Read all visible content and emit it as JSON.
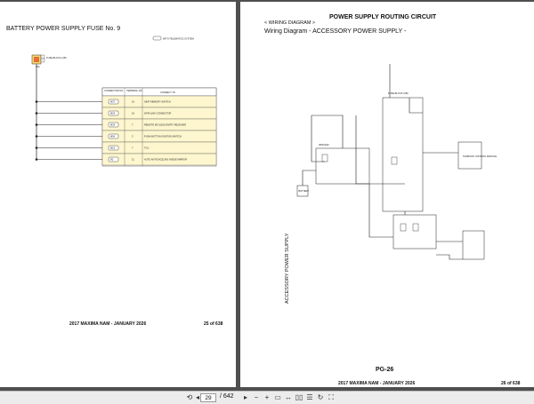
{
  "left_page": {
    "fuse_title": "BATTERY POWER SUPPLY FUSE No. 9",
    "note": "WITH TELEMATICS SYSTEM",
    "fuse_block": "FUSE BLOCK (J/B)",
    "fuse_amp": "10A",
    "table_headers": [
      "CONNECTOR NO.",
      "TERMINAL NO.",
      "CONNECT TO"
    ],
    "rows": [
      {
        "connector": "M37",
        "terminal": "16",
        "connect_to": "SEAT MEMORY SWITCH"
      },
      {
        "connector": "M24",
        "terminal": "16",
        "connect_to": "DATA LINK CONNECTOR"
      },
      {
        "connector": "M33",
        "terminal": "7",
        "connect_to": "REMOTE KEYLESS ENTRY RECEIVER"
      },
      {
        "connector": "M54",
        "terminal": "3",
        "connect_to": "PUSH-BUTTON IGNITION SWITCH"
      },
      {
        "connector": "M19",
        "terminal": "7",
        "connect_to": "TCU"
      },
      {
        "connector": "R2",
        "terminal": "11",
        "connect_to": "AUTO ANTI-DAZZLING INSIDE MIRROR"
      }
    ],
    "footer_model": "2017 MAXIMA NAM - JANUARY 2026",
    "footer_page": "25 of 638"
  },
  "right_page": {
    "title": "POWER SUPPLY ROUTING CIRCUIT",
    "link": "< WIRING DIAGRAM >",
    "subtitle": "Wiring Diagram - ACCESSORY POWER SUPPLY -",
    "vertical_label": "ACCESSORY POWER SUPPLY",
    "battery": "BATTERY",
    "ipdm": "IPDM E/R",
    "fuse_block": "FUSE BLOCK (J/B)",
    "module": "SUNROOF CONTROL MODULE",
    "pg": "PG-26",
    "footer_model": "2017 MAXIMA NAM - JANUARY 2026",
    "footer_page": "26 of 638"
  },
  "toolbar": {
    "current_page": "29",
    "total_pages": "/ 642",
    "icons": [
      "rotate-icon",
      "prev-page-icon",
      "next-page-icon",
      "zoom-out-icon",
      "zoom-in-icon",
      "fit-page-icon",
      "fit-width-icon",
      "two-page-icon",
      "continuous-icon",
      "rotate-page-icon",
      "fullscreen-icon"
    ]
  }
}
